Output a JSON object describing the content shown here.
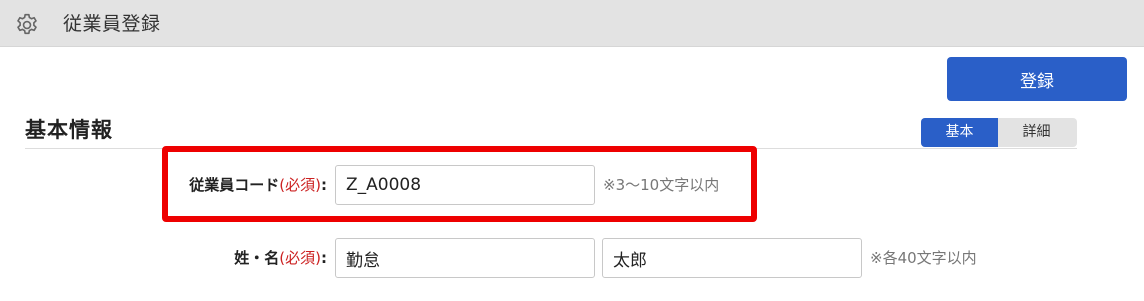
{
  "header": {
    "icon": "gear-icon",
    "title": "従業員登録"
  },
  "toolbar": {
    "register_label": "登録",
    "accent_color": "#2a5fc8"
  },
  "section": {
    "title": "基本情報",
    "tabs": [
      {
        "label": "基本",
        "active": true
      },
      {
        "label": "詳細",
        "active": false
      }
    ]
  },
  "form": {
    "employee_code": {
      "label": "従業員コード",
      "required": "(必須)",
      "colon": ":",
      "value": "Z_A0008",
      "hint": "※3〜10文字以内",
      "highlight_color": "#ee0000"
    },
    "name": {
      "label": "姓・名",
      "required": "(必須)",
      "colon": ":",
      "last_name": "勤怠",
      "first_name": "太郎",
      "hint": "※各40文字以内"
    }
  }
}
